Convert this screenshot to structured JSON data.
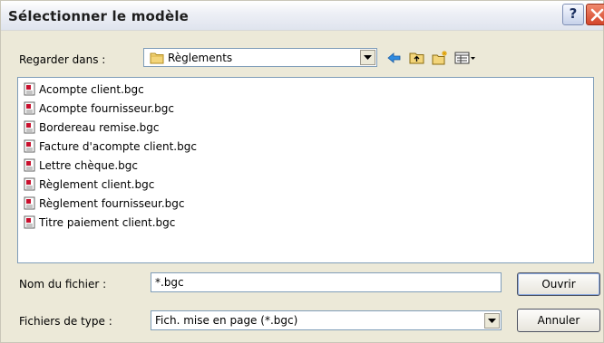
{
  "window": {
    "title": "Sélectionner le modèle",
    "help_label": "?"
  },
  "location": {
    "label": "Regarder dans :",
    "value": "Règlements",
    "icon": "folder-icon"
  },
  "files": [
    "Acompte client.bgc",
    "Acompte fournisseur.bgc",
    "Bordereau remise.bgc",
    "Facture d'acompte client.bgc",
    "Lettre chèque.bgc",
    "Règlement client.bgc",
    "Règlement fournisseur.bgc",
    "Titre paiement client.bgc"
  ],
  "filename": {
    "label": "Nom du fichier :",
    "value": "*.bgc"
  },
  "filetype": {
    "label": "Fichiers de type :",
    "value": "Fich. mise en page (*.bgc)"
  },
  "buttons": {
    "open": "Ouvrir",
    "cancel": "Annuler"
  },
  "colors": {
    "titlebar": "#eef0f6",
    "dialog_bg": "#ece9d8",
    "field_border": "#7f9db9",
    "close_button": "#d3452a"
  }
}
